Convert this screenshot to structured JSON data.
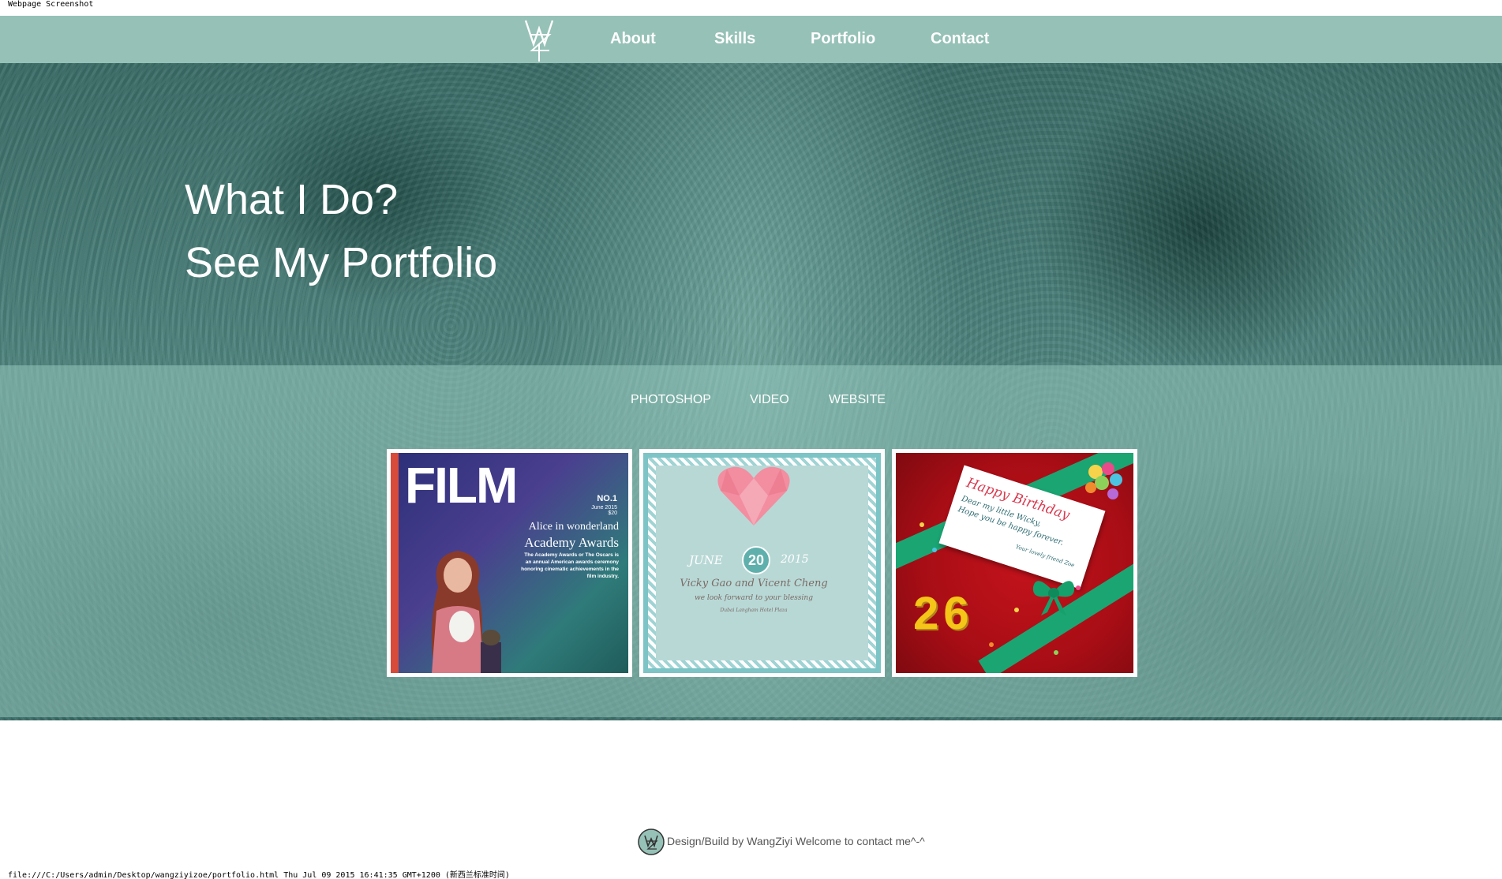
{
  "print": {
    "header": "Webpage Screenshot",
    "footer": "file:///C:/Users/admin/Desktop/wangziyizoe/portfolio.html Thu Jul 09 2015 16:41:35 GMT+1200 (新西兰标准时间)"
  },
  "nav": {
    "logo_icon": "wz-monogram-logo",
    "links": [
      "About",
      "Skills",
      "Portfolio",
      "Contact"
    ],
    "background": "#96c1b6"
  },
  "hero": {
    "title_line1": "What I Do?",
    "title_line2": "See My Portfolio"
  },
  "portfolio": {
    "tabs": [
      "PHOTOSHOP",
      "VIDEO",
      "WEBSITE"
    ],
    "cards": [
      {
        "title": "FILM",
        "issue": "NO.1",
        "date": "June 2015",
        "price": "$20",
        "subtitle1": "Alice in wonderland",
        "subtitle2": "Academy Awards",
        "blurb": "The Academy Awards or The Oscars is an annual American awards ceremony honoring cinematic achievements in the film industry."
      },
      {
        "month": "JUNE",
        "day": "20",
        "year": "2015",
        "names": "Vicky Gao and Vicent Cheng",
        "blessing": "we look forward to your blessing",
        "venue": "Dubai Langham Hotel Plaza"
      },
      {
        "title": "Happy Birthday",
        "line1": "Dear my little Wicky,",
        "line2": "Hope you be happy forever.",
        "signature": "Your lovely friend Zoe",
        "number": "26"
      }
    ]
  },
  "footer": {
    "text": "Design/Build by WangZiyi Welcome to contact me^-^"
  }
}
